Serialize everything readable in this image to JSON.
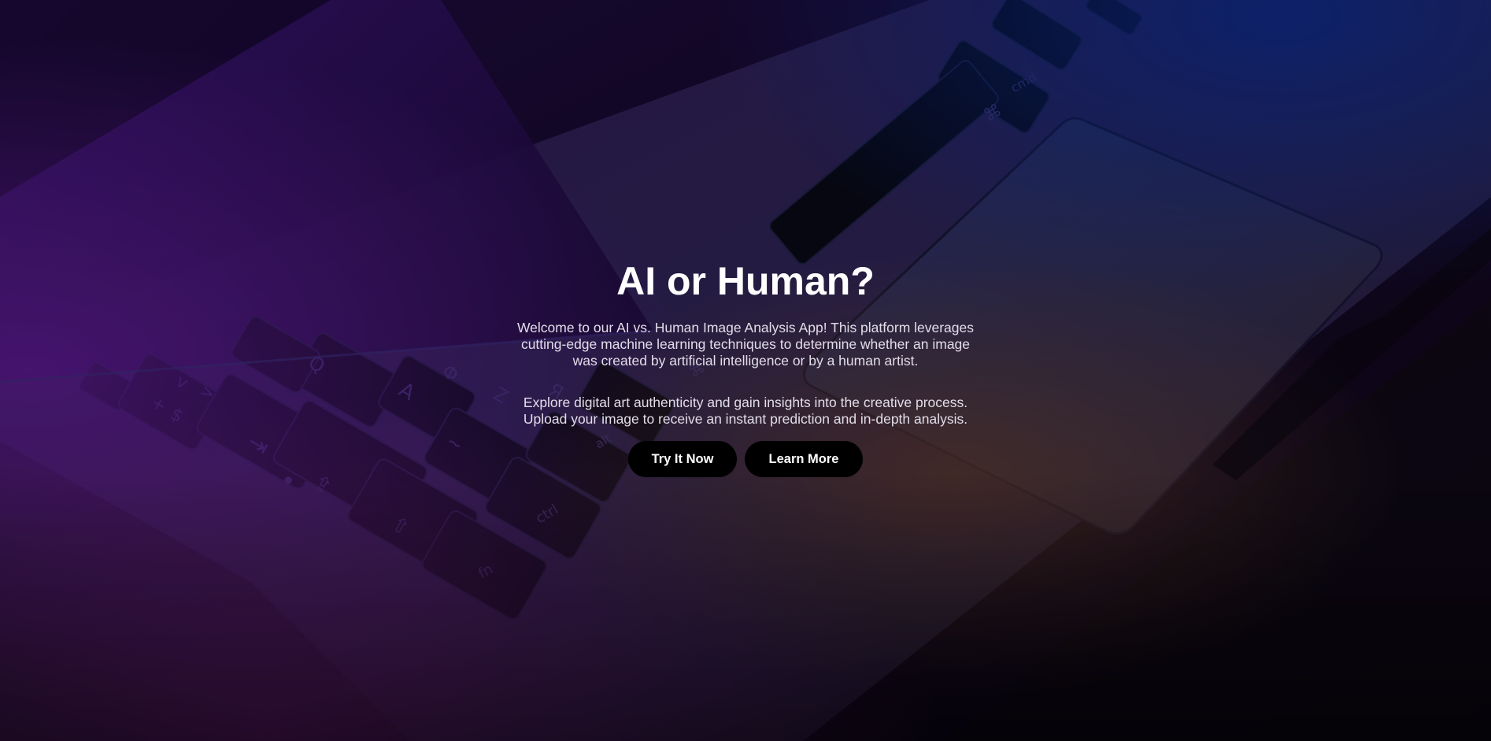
{
  "hero": {
    "title": "AI or Human?",
    "intro": "Welcome to our AI vs. Human Image Analysis App! This platform leverages cutting-edge machine learning techniques to determine whether an image was created by artificial intelligence or by a human artist.",
    "details": "Explore digital art authenticity and gain insights into the creative process. Upload your image to receive an instant prediction and in-depth analysis.",
    "buttons": {
      "try_label": "Try It Now",
      "learn_label": "Learn More"
    }
  },
  "background": {
    "keyboard_glyphs": [
      "+",
      "$",
      "v",
      ">",
      "⇥",
      "⇪",
      "●",
      "⇧",
      "A",
      "Φ",
      "Q",
      "Z",
      "Я",
      "~",
      "ctrl",
      "fn",
      "⌘",
      "cmd",
      "alt"
    ]
  },
  "colors": {
    "button_bg": "#000000",
    "button_text": "#ffffff",
    "title_text": "#ffffff",
    "body_text": "#e2dde9"
  }
}
